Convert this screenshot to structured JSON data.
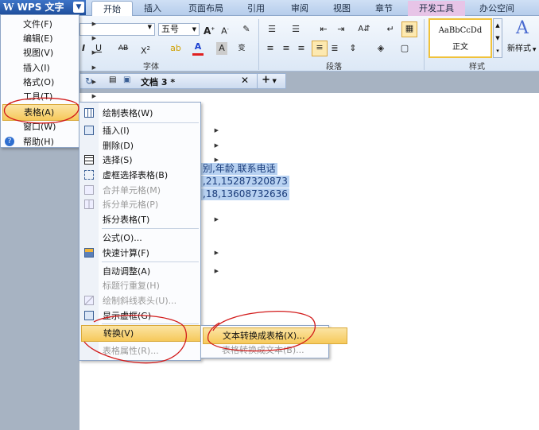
{
  "app": {
    "title": "WPS 文字"
  },
  "ribbon": {
    "tabs": [
      {
        "label": "开始"
      },
      {
        "label": "插入"
      },
      {
        "label": "页面布局"
      },
      {
        "label": "引用"
      },
      {
        "label": "审阅"
      },
      {
        "label": "视图"
      },
      {
        "label": "章节"
      },
      {
        "label": "开发工具"
      },
      {
        "label": "办公空间"
      }
    ],
    "font_size_value": "五号",
    "groups": {
      "font": "字体",
      "paragraph": "段落",
      "style": "样式"
    },
    "style_preview": "AaBbCcDd",
    "style_name": "正文",
    "new_style_label": "新样式"
  },
  "docbar": {
    "doc_name": "文档 3 *"
  },
  "main_menu": {
    "items": [
      {
        "label": "文件(F)"
      },
      {
        "label": "编辑(E)"
      },
      {
        "label": "视图(V)"
      },
      {
        "label": "插入(I)"
      },
      {
        "label": "格式(O)"
      },
      {
        "label": "工具(T)"
      },
      {
        "label": "表格(A)"
      },
      {
        "label": "窗口(W)"
      },
      {
        "label": "帮助(H)"
      }
    ]
  },
  "table_menu": {
    "items": [
      {
        "label": "绘制表格(W)"
      },
      {
        "label": "插入(I)"
      },
      {
        "label": "删除(D)"
      },
      {
        "label": "选择(S)"
      },
      {
        "label": "虚框选择表格(B)"
      },
      {
        "label": "合并单元格(M)"
      },
      {
        "label": "拆分单元格(P)"
      },
      {
        "label": "拆分表格(T)"
      },
      {
        "label": "公式(O)..."
      },
      {
        "label": "快速计算(F)"
      },
      {
        "label": "自动调整(A)"
      },
      {
        "label": "标题行重复(H)"
      },
      {
        "label": "绘制斜线表头(U)..."
      },
      {
        "label": "显示虚框(G)"
      },
      {
        "label": "转换(V)"
      },
      {
        "label": "表格属性(R)..."
      }
    ]
  },
  "convert_menu": {
    "items": [
      {
        "label": "文本转换成表格(X)..."
      },
      {
        "label": "表格转换成文本(B)..."
      }
    ]
  },
  "document": {
    "lines": [
      "别,年龄,联系电话",
      ",21,15287320873",
      ",18,13608732636"
    ]
  },
  "colors": {
    "highlight": "#f6c95b",
    "selection": "#b7d1f1",
    "annotation": "#d21a1a"
  }
}
